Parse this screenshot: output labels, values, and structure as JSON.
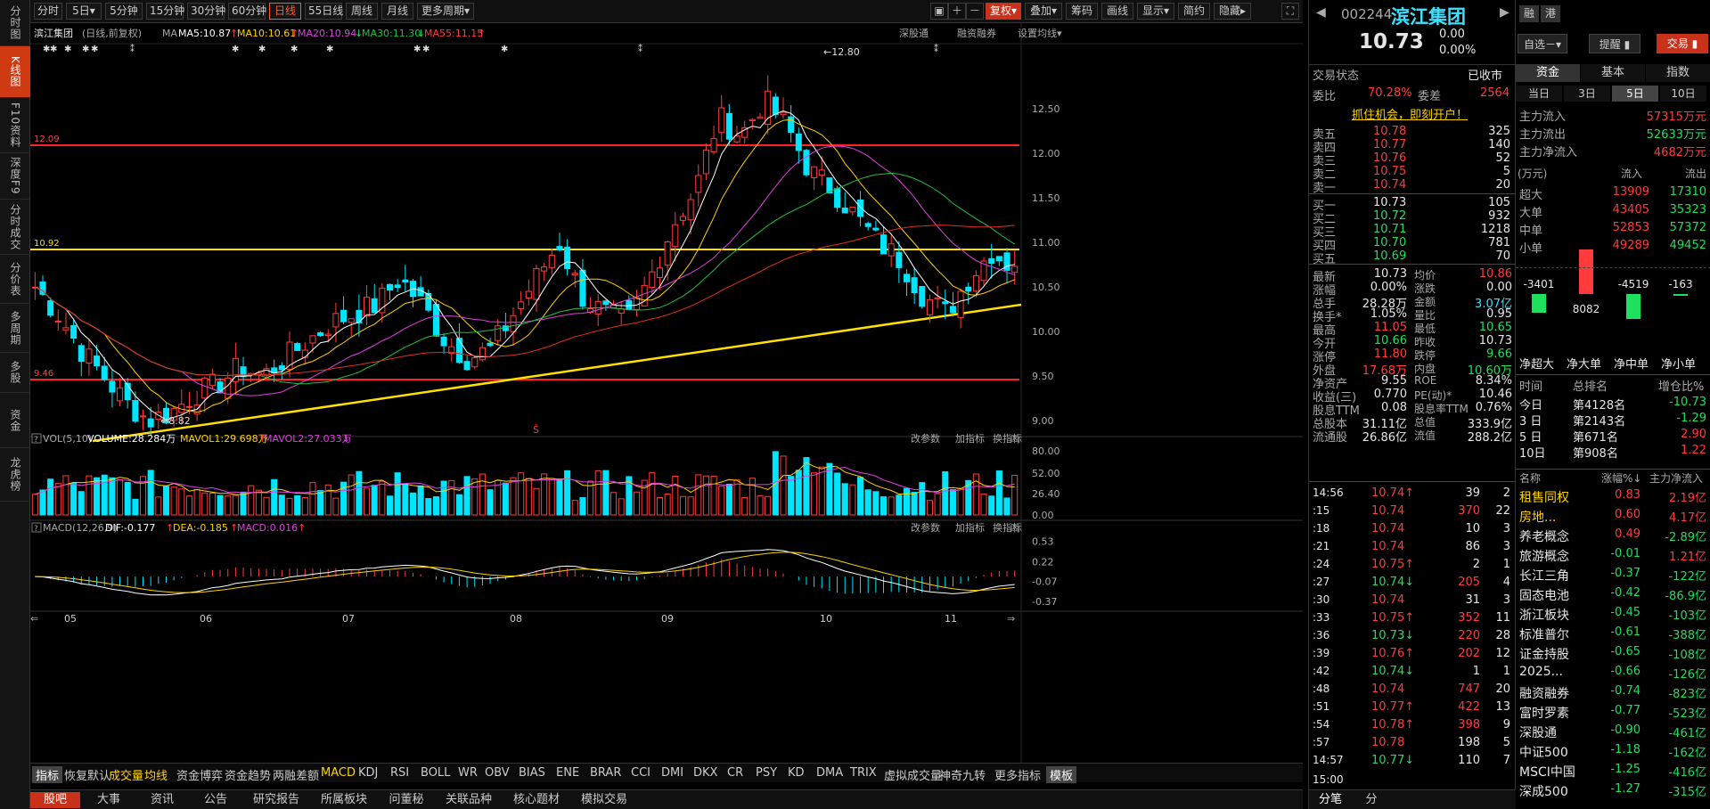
{
  "colors": {
    "up": "#ff3b3b",
    "down": "#00e5ff",
    "accent": "#c8321a",
    "ma5": "#ffffff",
    "ma10": "#ffd200",
    "ma20": "#e040e0",
    "ma30": "#20c040",
    "ma55": "#e0301e"
  },
  "left_nav": [
    "分时图",
    "K线图",
    "F10资料",
    "深度F9",
    "分时成交",
    "分价表",
    "多周期",
    "多股",
    "资金",
    "龙虎榜"
  ],
  "toolbar": {
    "periods": [
      "分时",
      "5日▾",
      "5分钟",
      "15分钟",
      "30分钟",
      "60分钟",
      "日线",
      "55日线",
      "周线",
      "月线",
      "更多周期▾"
    ],
    "active_period": "日线",
    "right_buttons": [
      "复权▾",
      "叠加▾",
      "筹码",
      "画线",
      "显示▾",
      "简约",
      "隐藏▸"
    ]
  },
  "chart_header": {
    "name": "滨江集团",
    "mode": "(日线,前复权)",
    "ma_label": "MA",
    "ma5": "MA5:10.87",
    "ma10": "MA10:10.61",
    "ma20": "MA20:10.94",
    "ma30": "MA30:11.30",
    "ma55": "MA55:11.15",
    "links": [
      "深股通",
      "融资融券",
      "设置均线▾"
    ]
  },
  "price_axis": [
    "12.50",
    "12.00",
    "11.50",
    "11.00",
    "10.50",
    "10.00",
    "9.50",
    "9.00"
  ],
  "hlines": {
    "red_top": "12.09",
    "yellow": "10.92",
    "red_bottom": "9.46"
  },
  "annotations": {
    "high": "12.80",
    "low": "8.82",
    "mark": "Ŝ"
  },
  "vol_header": {
    "label": "VOL(5,10)",
    "volume": "VOLUME:28.284万",
    "mavol1": "MAVOL1:29.698万",
    "mavol2": "MAVOL2:27.033万",
    "links": [
      "改参数",
      "加指标",
      "换指标"
    ]
  },
  "vol_axis": [
    "80.00",
    "52.00",
    "26.40",
    "0.00"
  ],
  "macd_header": {
    "label": "MACD(12,26,9)",
    "dif": "DIF:-0.177",
    "dea": "DEA:-0.185",
    "macd": "MACD:0.016",
    "links": [
      "改参数",
      "加指标",
      "换指标"
    ]
  },
  "macd_axis": [
    "0.53",
    "0.22",
    "-0.07",
    "-0.37"
  ],
  "months": [
    "05",
    "06",
    "07",
    "08",
    "09",
    "10",
    "11"
  ],
  "indicator_tabs": [
    "指标",
    "恢复默认",
    "成交量",
    "均线",
    "资金博弈",
    "资金趋势",
    "两融差额",
    "MACD",
    "KDJ",
    "RSI",
    "BOLL",
    "WR",
    "OBV",
    "BIAS",
    "ENE",
    "BRAR",
    "CCI",
    "DMI",
    "DKX",
    "CR",
    "PSY",
    "KD",
    "DMA",
    "TRIX",
    "虚拟成交量",
    "神奇九转",
    "更多指标",
    "模板"
  ],
  "bottom_tabs": [
    "股吧",
    "大事",
    "资讯",
    "公告",
    "研究报告",
    "所属板块",
    "问董秘",
    "关联品种",
    "核心题材",
    "模拟交易"
  ],
  "quote": {
    "code": "002244",
    "name": "滨江集团",
    "price": "10.73",
    "change": "0.00",
    "pct": "0.00%",
    "btn_watch": "自选－▾",
    "btn_alert": "提醒 ▮",
    "btn_trade": "交易 ▮",
    "status_label": "交易状态",
    "status": "已收市",
    "weibi_label": "委比",
    "weibi": "70.28%",
    "weicha_label": "委差",
    "weicha": "2564",
    "promo": "抓住机会，即刻开户！"
  },
  "sells": [
    [
      "卖五",
      "10.78",
      "325"
    ],
    [
      "卖四",
      "10.77",
      "140"
    ],
    [
      "卖三",
      "10.76",
      "52"
    ],
    [
      "卖二",
      "10.75",
      "5"
    ],
    [
      "卖一",
      "10.74",
      "20"
    ]
  ],
  "buys": [
    [
      "买一",
      "10.73",
      "105"
    ],
    [
      "买二",
      "10.72",
      "932"
    ],
    [
      "买三",
      "10.71",
      "1218"
    ],
    [
      "买四",
      "10.70",
      "781"
    ],
    [
      "买五",
      "10.69",
      "70"
    ]
  ],
  "stats": [
    [
      "最新",
      "10.73",
      "均价",
      "10.86"
    ],
    [
      "涨幅",
      "0.00%",
      "涨跌",
      "0.00"
    ],
    [
      "总手",
      "28.28万",
      "金额",
      "3.07亿"
    ],
    [
      "换手*",
      "1.05%",
      "量比",
      "0.95"
    ],
    [
      "最高",
      "11.05",
      "最低",
      "10.65"
    ],
    [
      "今开",
      "10.66",
      "昨收",
      "10.73"
    ],
    [
      "涨停",
      "11.80",
      "跌停",
      "9.66"
    ],
    [
      "外盘",
      "17.68万",
      "内盘",
      "10.60万"
    ],
    [
      "净资产",
      "9.55",
      "ROE",
      "8.34%"
    ],
    [
      "收益(三)",
      "0.770",
      "PE(动)*",
      "10.46"
    ],
    [
      "股息TTM",
      "0.08",
      "股息率TTM",
      "0.76%"
    ],
    [
      "总股本",
      "31.11亿",
      "总值",
      "333.9亿"
    ],
    [
      "流通股",
      "26.86亿",
      "流值",
      "288.2亿"
    ]
  ],
  "ticks": [
    [
      "14:56",
      "10.74↑",
      "39",
      "2"
    ],
    [
      ":15",
      "10.74",
      "370",
      "22"
    ],
    [
      ":18",
      "10.74",
      "10",
      "3"
    ],
    [
      ":21",
      "10.74",
      "86",
      "3"
    ],
    [
      ":24",
      "10.75↑",
      "2",
      "1"
    ],
    [
      ":27",
      "10.74↓",
      "205",
      "4"
    ],
    [
      ":30",
      "10.74",
      "31",
      "3"
    ],
    [
      ":33",
      "10.75↑",
      "352",
      "11"
    ],
    [
      ":36",
      "10.73↓",
      "220",
      "28"
    ],
    [
      ":39",
      "10.76↑",
      "202",
      "12"
    ],
    [
      ":42",
      "10.74↓",
      "1",
      "1"
    ],
    [
      ":48",
      "10.74",
      "747",
      "20"
    ],
    [
      ":51",
      "10.77↑",
      "422",
      "13"
    ],
    [
      ":54",
      "10.78↑",
      "398",
      "9"
    ],
    [
      ":57",
      "10.78",
      "198",
      "5"
    ],
    [
      "14:57",
      "10.77↓",
      "110",
      "7"
    ],
    [
      "15:00",
      "",
      "",
      ""
    ]
  ],
  "fund_tabs": [
    "资金",
    "基本",
    "指数"
  ],
  "day_tabs": [
    "当日",
    "3日",
    "5日",
    "10日"
  ],
  "fund_flow": [
    [
      "主力流入",
      "57315万元"
    ],
    [
      "主力流出",
      "52633万元"
    ],
    [
      "主力净流入",
      "4682万元"
    ]
  ],
  "flow_header": [
    "(万元)",
    "流入",
    "流出"
  ],
  "flow_rows": [
    [
      "超大",
      "13909",
      "17310"
    ],
    [
      "大单",
      "43405",
      "35323"
    ],
    [
      "中单",
      "52853",
      "57372"
    ],
    [
      "小单",
      "49289",
      "49452"
    ]
  ],
  "net_bars": [
    [
      "净超大",
      "-3401"
    ],
    [
      "净大单",
      "8082"
    ],
    [
      "净中单",
      "-4519"
    ],
    [
      "净小单",
      "-163"
    ]
  ],
  "rank_header": [
    "时间",
    "总排名",
    "增仓比%"
  ],
  "rank_rows": [
    [
      "今日",
      "第4128名",
      "-10.73"
    ],
    [
      "3 日",
      "第2143名",
      "-1.29"
    ],
    [
      "5 日",
      "第671名",
      "2.90"
    ],
    [
      "10日",
      "第908名",
      "1.22"
    ]
  ],
  "sector_header": [
    "名称",
    "涨幅%↓",
    "主力净流入"
  ],
  "sectors": [
    [
      "租售同权",
      "0.83",
      "2.19亿"
    ],
    [
      "房地...",
      "0.60",
      "4.17亿"
    ],
    [
      "养老概念",
      "0.49",
      "-2.89亿"
    ],
    [
      "旅游概念",
      "-0.01",
      "1.21亿"
    ],
    [
      "长江三角",
      "-0.37",
      "-122亿"
    ],
    [
      "固态电池",
      "-0.42",
      "-86.9亿"
    ],
    [
      "浙江板块",
      "-0.45",
      "-103亿"
    ],
    [
      "标准普尔",
      "-0.61",
      "-388亿"
    ],
    [
      "证金持股",
      "-0.65",
      "-108亿"
    ],
    [
      "2025...",
      "-0.66",
      "-126亿"
    ],
    [
      "融资融券",
      "-0.74",
      "-823亿"
    ],
    [
      "富时罗素",
      "-0.77",
      "-523亿"
    ],
    [
      "深股通",
      "-0.90",
      "-461亿"
    ],
    [
      "中证500",
      "-1.18",
      "-162亿"
    ],
    [
      "MSCI中国",
      "-1.25",
      "-416亿"
    ],
    [
      "深成500",
      "-1.27",
      "-315亿"
    ]
  ],
  "right_bottom_tabs": [
    "分笔",
    "分"
  ]
}
